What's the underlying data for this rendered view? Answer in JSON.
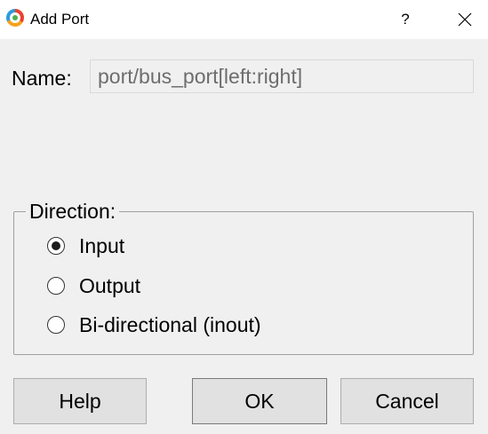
{
  "window": {
    "title": "Add Port",
    "help_label": "?",
    "app_icon": "app-logo-icon",
    "close_icon": "close-icon"
  },
  "name": {
    "label": "Name:",
    "value": "",
    "placeholder": "port/bus_port[left:right]"
  },
  "direction": {
    "legend": "Direction:",
    "options": [
      {
        "label": "Input",
        "checked": true
      },
      {
        "label": "Output",
        "checked": false
      },
      {
        "label": "Bi-directional (inout)",
        "checked": false
      }
    ]
  },
  "buttons": {
    "help": "Help",
    "ok": "OK",
    "cancel": "Cancel"
  },
  "colors": {
    "background": "#f0f0f0",
    "titlebar": "#ffffff",
    "button_face": "#e1e1e1",
    "placeholder_text": "#6d6d6d"
  }
}
